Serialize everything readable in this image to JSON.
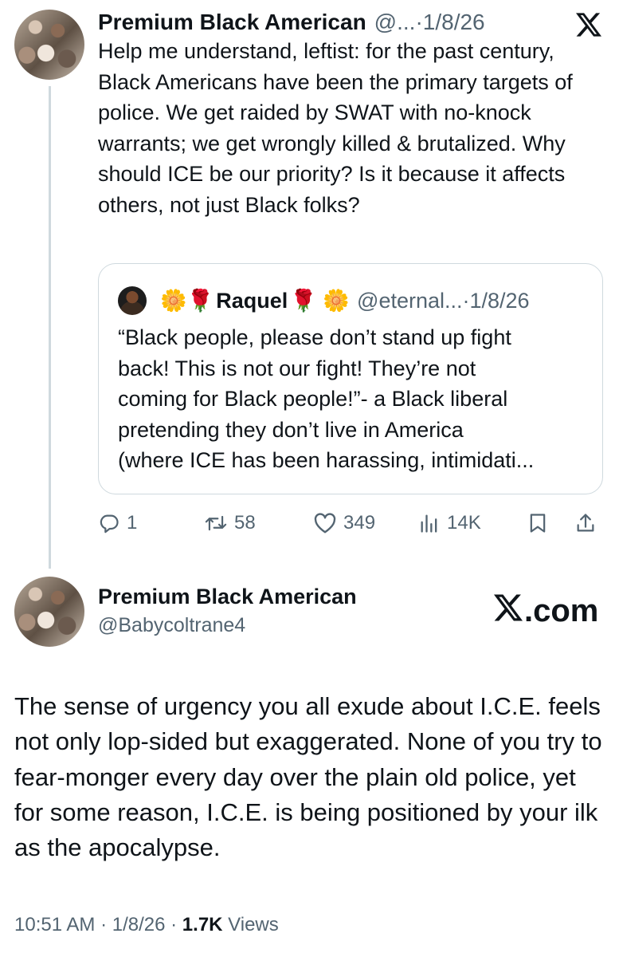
{
  "reply_context_tweet": {
    "author_name": "Premium Black American",
    "handle_truncated": "@...",
    "separator": " · ",
    "date": "1/8/26",
    "text": "Help me understand, leftist: for the past century, Black Americans have been the primary targets of police. We get raided by SWAT with no-knock warrants; we get wrongly killed & brutalized. Why should ICE be our priority? Is it because it affects others, not just Black folks?",
    "quote": {
      "emoji_left": "🌼🌹",
      "author_name": "Raquel",
      "emoji_right": "🌹 🌼",
      "handle_truncated": "@eternal...",
      "separator": " · ",
      "date": "1/8/26",
      "lines": [
        "“Black people, please don’t stand up fight",
        "back! This is not our fight! They’re not",
        "coming for Black people!”- a Black liberal",
        "pretending they don’t live in America",
        "(where ICE has been harassing, intimidati..."
      ]
    },
    "metrics": {
      "replies": "1",
      "reposts": "58",
      "likes": "349",
      "views": "14K"
    },
    "icons": [
      "reply-icon",
      "repost-icon",
      "like-icon",
      "views-icon",
      "bookmark-icon",
      "share-icon",
      "x-logo-icon"
    ]
  },
  "main_tweet": {
    "author_name": "Premium Black American",
    "handle": "@Babycoltrane4",
    "watermark": ".com",
    "text": "The sense of urgency you all exude about I.C.E. feels not only lop-sided but exaggerated. None of you try to fear-monger every day over the plain old police, yet for some reason, I.C.E. is being positioned by your ilk as the apocalypse.",
    "footer": {
      "time": "10:51 AM",
      "sep1": " · ",
      "date": "1/8/26",
      "sep2": " · ",
      "views_count": "1.7K",
      "views_label": " Views"
    }
  },
  "colors": {
    "text": "#0f1419",
    "muted": "#536471",
    "border": "#cfd9de",
    "background": "#ffffff"
  }
}
